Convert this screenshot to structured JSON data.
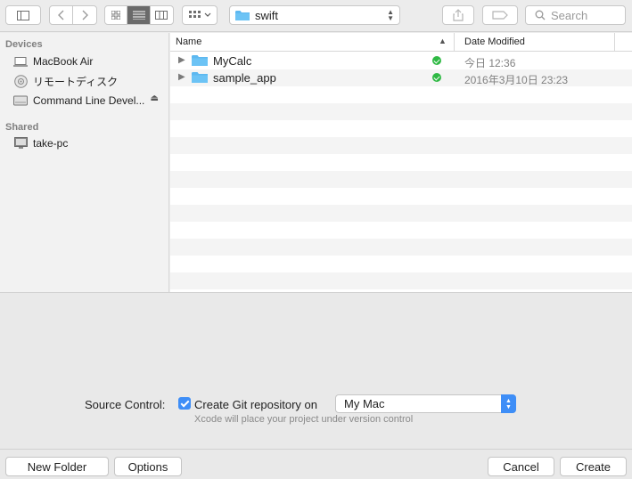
{
  "toolbar": {
    "location": "swift",
    "search_placeholder": "Search",
    "view_modes": [
      "icon-view",
      "list-view",
      "column-view"
    ],
    "active_view": "list-view"
  },
  "sidebar": {
    "devices_heading": "Devices",
    "devices": [
      {
        "label": "MacBook Air",
        "icon": "laptop-icon"
      },
      {
        "label": "リモートディスク",
        "icon": "disc-icon"
      },
      {
        "label": "Command Line Devel...",
        "icon": "drive-icon",
        "ejectable": true
      }
    ],
    "shared_heading": "Shared",
    "shared": [
      {
        "label": "take-pc",
        "icon": "computer-icon"
      }
    ]
  },
  "browser": {
    "columns": {
      "name": "Name",
      "date_modified": "Date Modified"
    },
    "sort_column": "Name",
    "rows": [
      {
        "name": "MyCalc",
        "date": "今日 12:36",
        "status": "git-synced"
      },
      {
        "name": "sample_app",
        "date": "2016年3月10日 23:23",
        "status": "git-synced"
      }
    ]
  },
  "source_control": {
    "label": "Source Control:",
    "checkbox_label": "Create Git repository on",
    "checked": true,
    "location": "My Mac",
    "hint": "Xcode will place your project under version control"
  },
  "footer": {
    "new_folder": "New Folder",
    "options": "Options",
    "cancel": "Cancel",
    "create": "Create"
  },
  "colors": {
    "accent": "#3e8ef7",
    "folder": "#5db8f0",
    "status_ok": "#2fb944"
  }
}
